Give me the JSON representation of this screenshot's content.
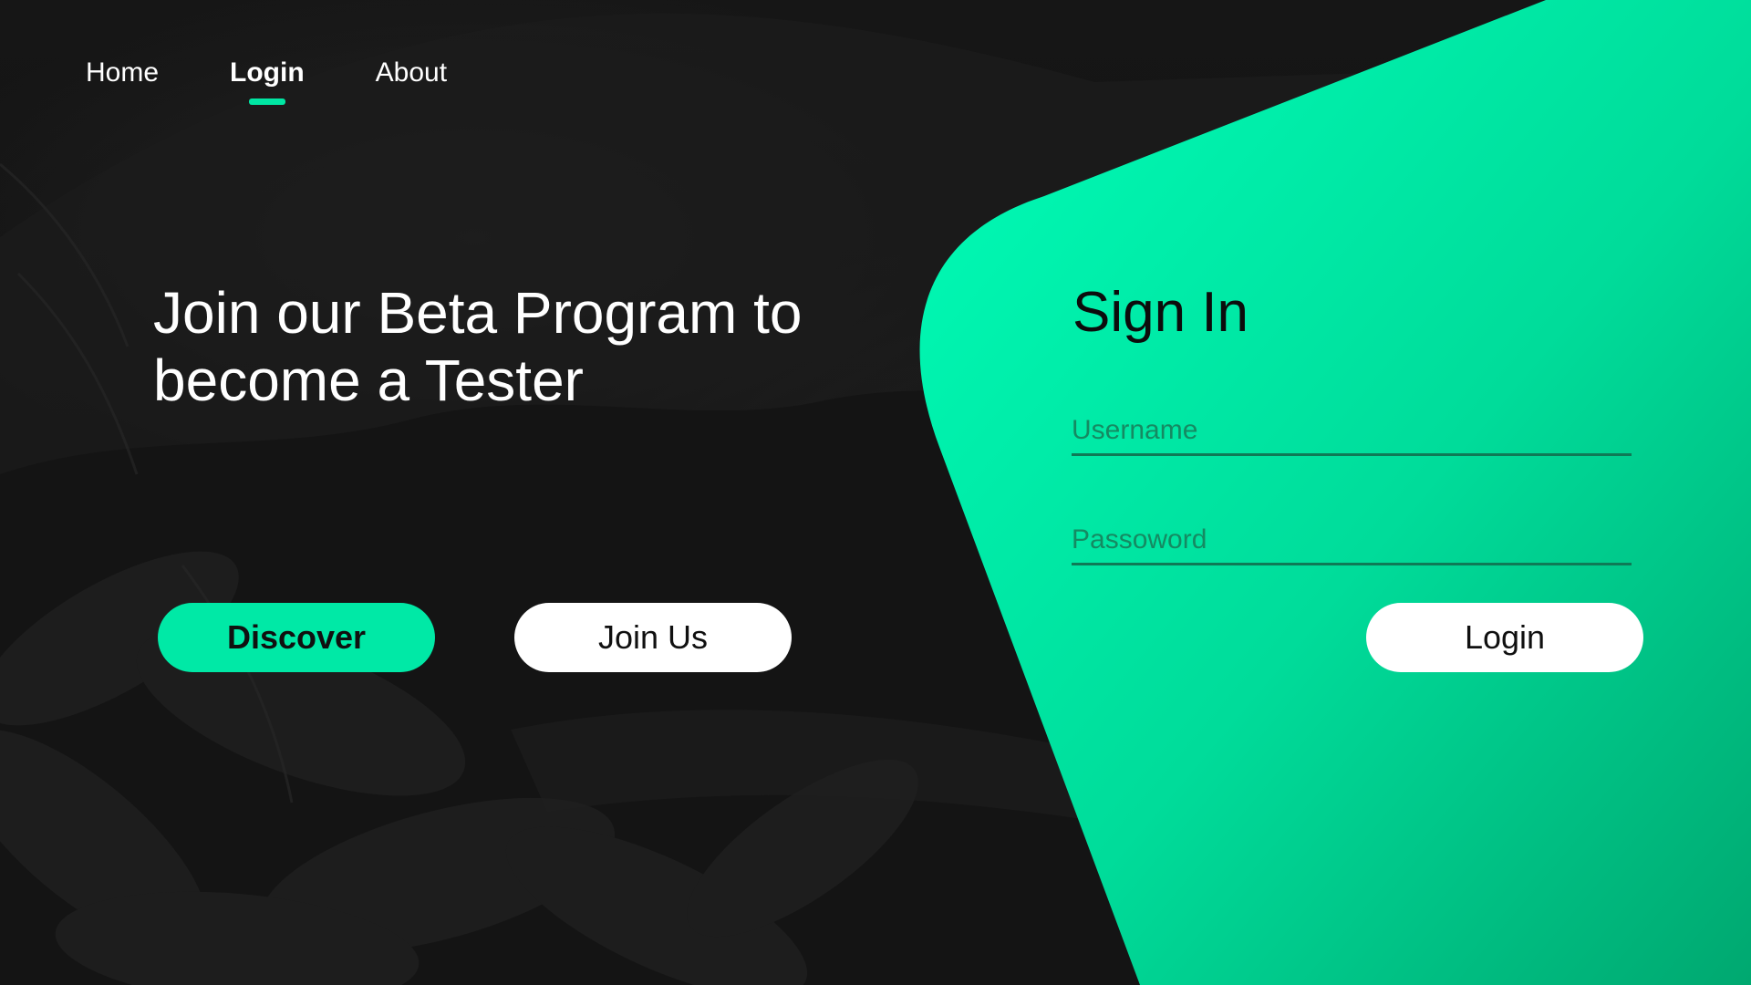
{
  "nav": {
    "items": [
      {
        "label": "Home"
      },
      {
        "label": "Login",
        "active": true
      },
      {
        "label": "About"
      }
    ]
  },
  "hero": {
    "title_line1": "Join our Beta Program to",
    "title_line2": "become a Tester",
    "discover_label": "Discover",
    "join_label": "Join Us"
  },
  "signin": {
    "title": "Sign In",
    "username_placeholder": "Username",
    "password_placeholder": "Passoword",
    "login_label": "Login"
  },
  "colors": {
    "accent": "#00e9a6",
    "accent_dark": "#00b479",
    "background": "#0d0d0d",
    "text_light": "#ffffff",
    "text_dark": "#101010"
  }
}
